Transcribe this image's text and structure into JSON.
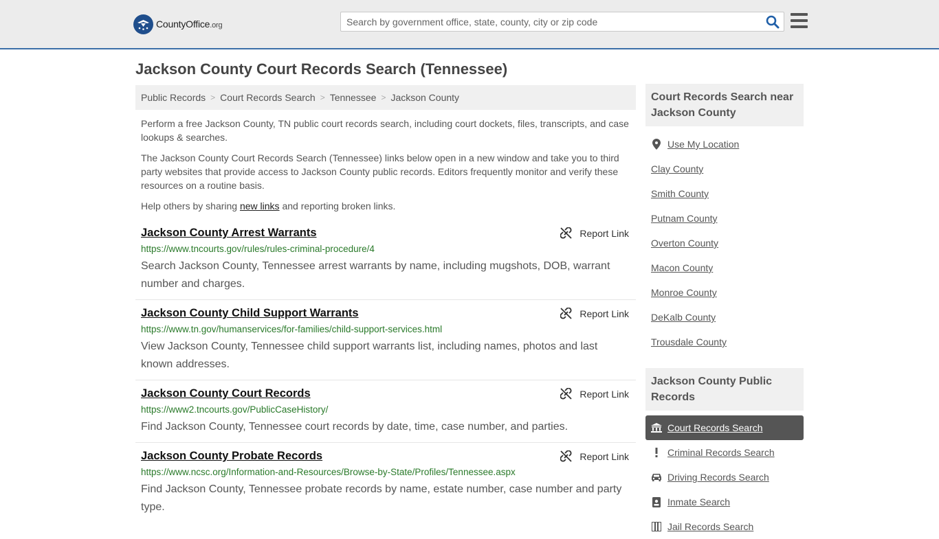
{
  "header": {
    "brand_main": "CountyOffice",
    "brand_tld": ".org",
    "search_placeholder": "Search by government office, state, county, city or zip code"
  },
  "page": {
    "title": "Jackson County Court Records Search (Tennessee)"
  },
  "breadcrumb": [
    "Public Records",
    "Court Records Search",
    "Tennessee",
    "Jackson County"
  ],
  "intro": {
    "p1": "Perform a free Jackson County, TN public court records search, including court dockets, files, transcripts, and case lookups & searches.",
    "p2": "The Jackson County Court Records Search (Tennessee) links below open in a new window and take you to third party websites that provide access to Jackson County public records. Editors frequently monitor and verify these resources on a routine basis.",
    "p3_before": "Help others by sharing ",
    "p3_link": "new links",
    "p3_after": " and reporting broken links."
  },
  "results": [
    {
      "title": "Jackson County Arrest Warrants",
      "url": "https://www.tncourts.gov/rules/rules-criminal-procedure/4",
      "desc": "Search Jackson County, Tennessee arrest warrants by name, including mugshots, DOB, warrant number and charges.",
      "report": "Report Link"
    },
    {
      "title": "Jackson County Child Support Warrants",
      "url": "https://www.tn.gov/humanservices/for-families/child-support-services.html",
      "desc": "View Jackson County, Tennessee child support warrants list, including names, photos and last known addresses.",
      "report": "Report Link"
    },
    {
      "title": "Jackson County Court Records",
      "url": "https://www2.tncourts.gov/PublicCaseHistory/",
      "desc": "Find Jackson County, Tennessee court records by date, time, case number, and parties.",
      "report": "Report Link"
    },
    {
      "title": "Jackson County Probate Records",
      "url": "https://www.ncsc.org/Information-and-Resources/Browse-by-State/Profiles/Tennessee.aspx",
      "desc": "Find Jackson County, Tennessee probate records by name, estate number, case number and party type.",
      "report": "Report Link"
    }
  ],
  "sidebar": {
    "nearby_heading": "Court Records Search near Jackson County",
    "use_location": "Use My Location",
    "nearby": [
      "Clay County",
      "Smith County",
      "Putnam County",
      "Overton County",
      "Macon County",
      "Monroe County",
      "DeKalb County",
      "Trousdale County"
    ],
    "public_heading": "Jackson County Public Records",
    "public_links": [
      {
        "label": "Court Records Search",
        "icon": "courthouse-icon"
      },
      {
        "label": "Criminal Records Search",
        "icon": "exclamation-icon"
      },
      {
        "label": "Driving Records Search",
        "icon": "car-icon"
      },
      {
        "label": "Inmate Search",
        "icon": "id-badge-icon"
      },
      {
        "label": "Jail Records Search",
        "icon": "jail-icon"
      }
    ]
  },
  "colors": {
    "accent": "#3b6ea8",
    "url_green": "#2a7a2a",
    "active_bg": "#555555"
  }
}
